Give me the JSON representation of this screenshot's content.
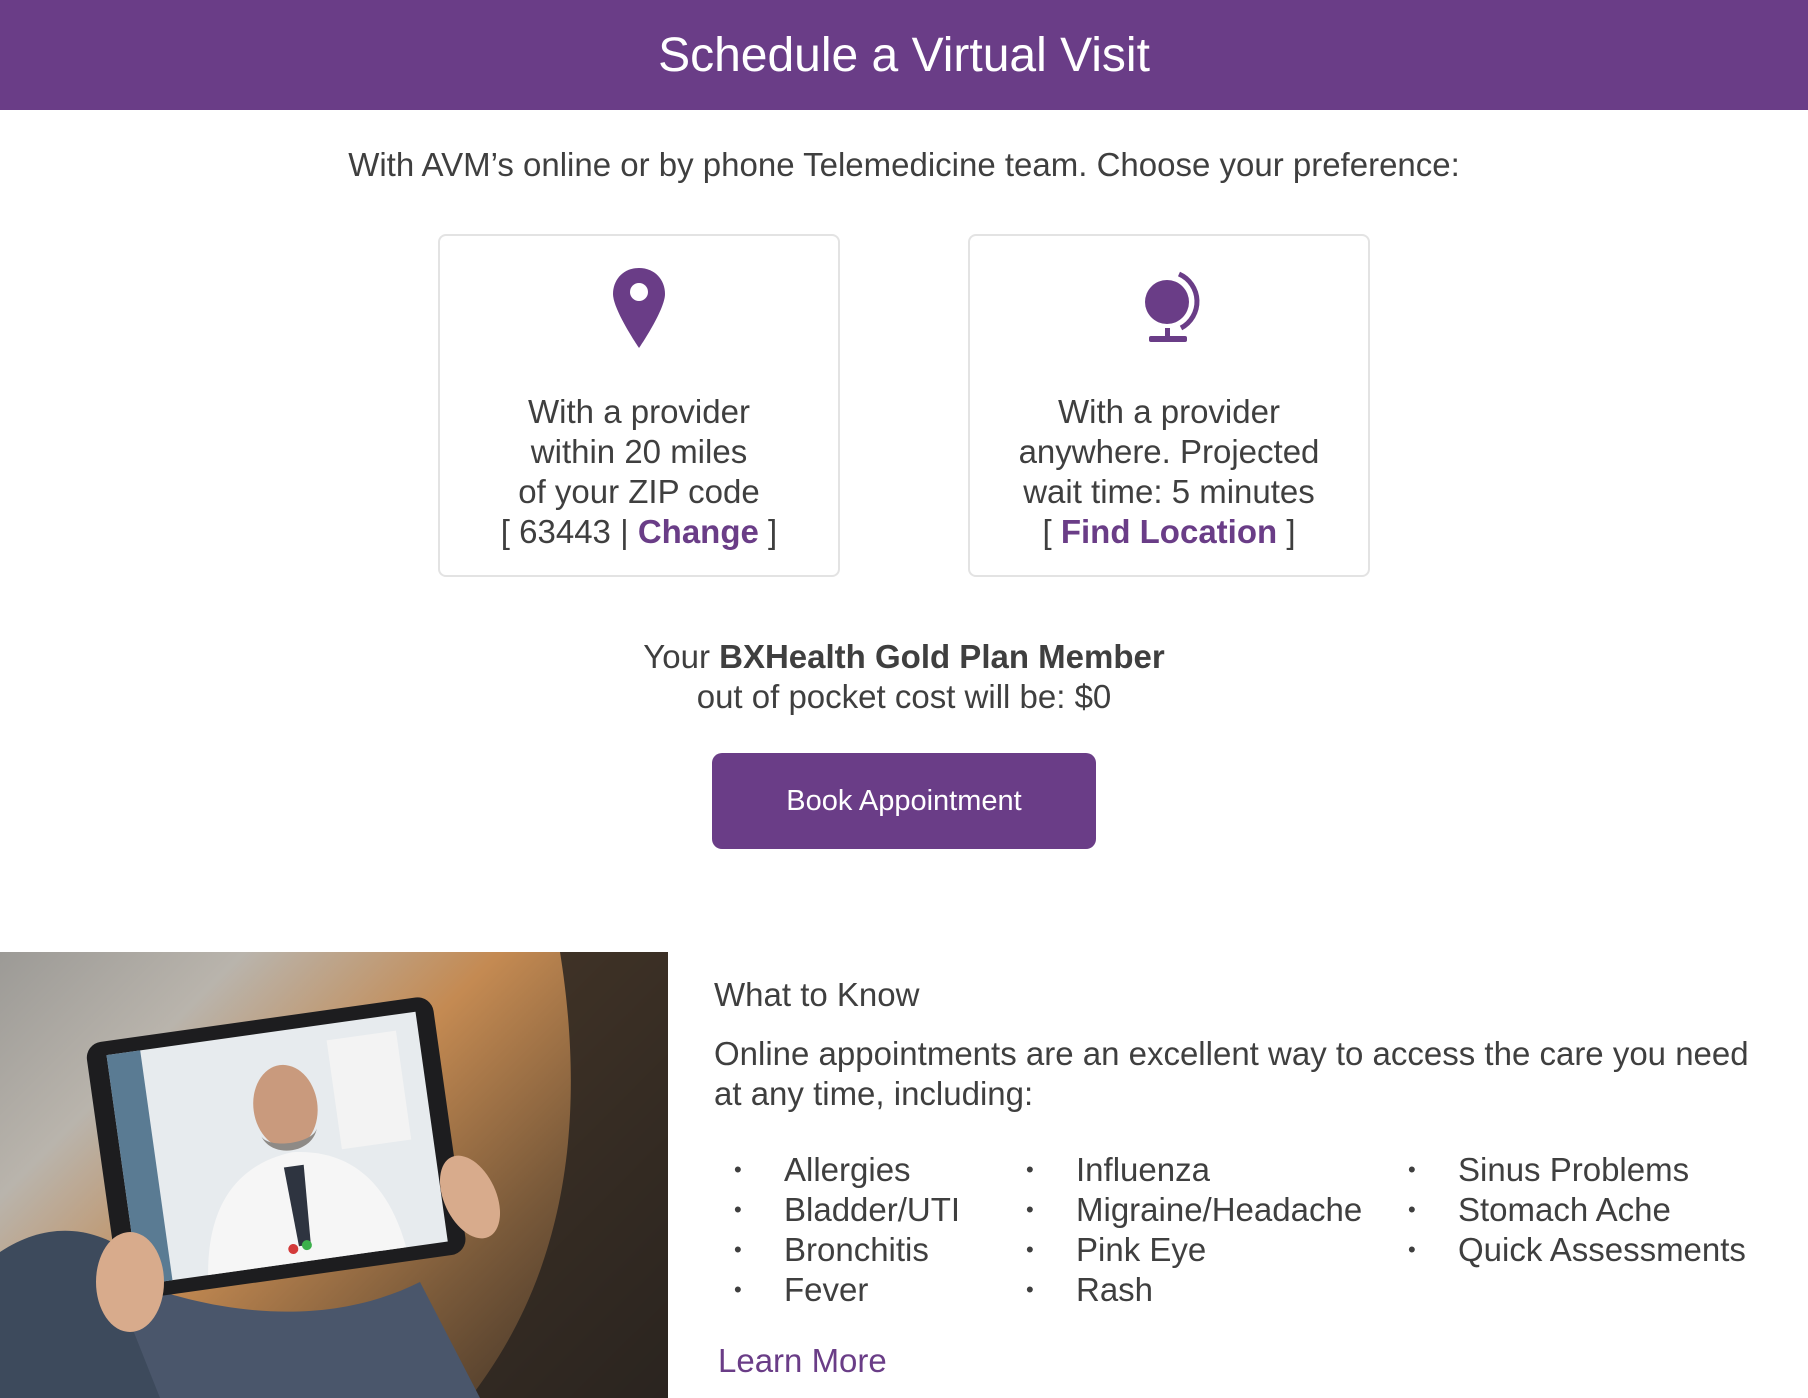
{
  "header": {
    "title": "Schedule a Virtual Visit"
  },
  "subtitle": "With AVM’s online or by phone Telemedicine team. Choose your preference:",
  "cards": [
    {
      "icon": "map-pin-icon",
      "lines": [
        "With a provider",
        "within 20 miles",
        "of your ZIP code"
      ],
      "zip": "63443",
      "link": "Change"
    },
    {
      "icon": "globe-icon",
      "lines": [
        "With a provider",
        "anywhere. Projected",
        "wait time: 5 minutes"
      ],
      "link": "Find Location"
    }
  ],
  "plan": {
    "prefix": "Your",
    "name": "BXHealth Gold Plan Member",
    "cost_line": "out of pocket cost will be: $0"
  },
  "book_button": "Book Appointment",
  "info": {
    "heading": "What to Know",
    "description": "Online appointments are an excellent way to access the care you need at any time, including:",
    "columns": [
      [
        "Allergies",
        "Bladder/UTI",
        "Bronchitis",
        "Fever"
      ],
      [
        "Influenza",
        "Migraine/Headache",
        "Pink Eye",
        "Rash"
      ],
      [
        "Sinus Problems",
        "Stomach Ache",
        "Quick Assessments"
      ]
    ],
    "learn_more": "Learn More"
  },
  "colors": {
    "brand": "#6a3d87",
    "text": "#3f3f3f",
    "border": "#e3e3e3"
  }
}
